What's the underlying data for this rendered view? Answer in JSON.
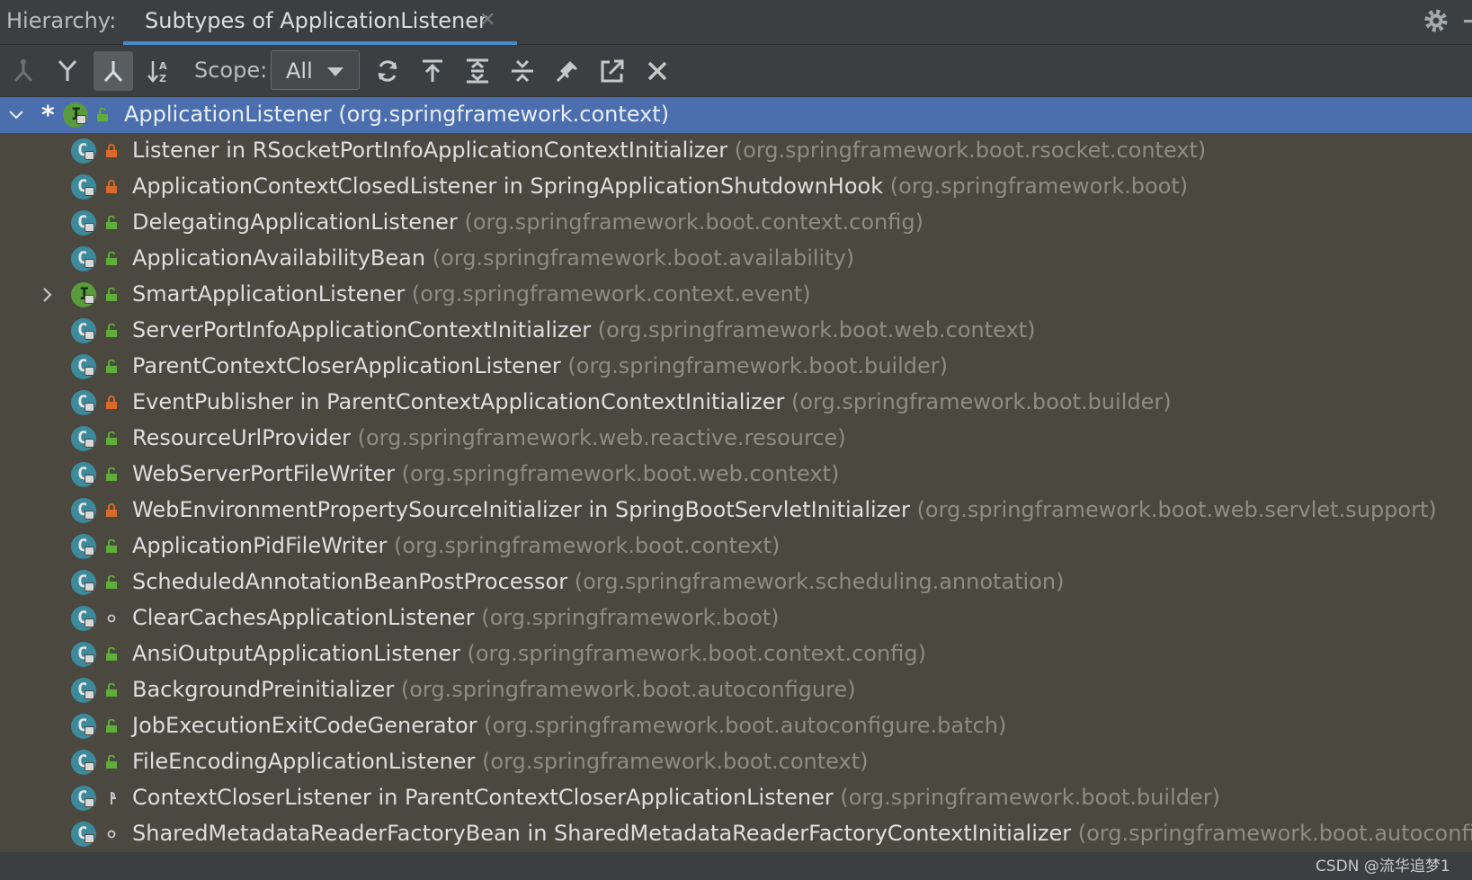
{
  "header": {
    "title": "Hierarchy:",
    "tab_label": "Subtypes of ApplicationListener"
  },
  "toolbar": {
    "scope_label": "Scope:",
    "scope_value": "All",
    "buttons": [
      "class-hierarchy-icon",
      "supertypes-icon",
      "subtypes-icon",
      "sort-alpha-icon",
      "refresh-icon",
      "base-on-this-class-icon",
      "expand-all-icon",
      "collapse-all-icon",
      "pin-icon",
      "export-icon",
      "close-icon"
    ]
  },
  "tree": {
    "root": {
      "name": "ApplicationListener",
      "pkg": "(org.springframework.context)",
      "kind": "interface",
      "visibility": "public",
      "expanded": true
    },
    "rows": [
      {
        "name": "Listener in RSocketPortInfoApplicationContextInitializer",
        "pkg": "(org.springframework.boot.rsocket.context)",
        "kind": "class",
        "visibility": "private"
      },
      {
        "name": "ApplicationContextClosedListener in SpringApplicationShutdownHook",
        "pkg": "(org.springframework.boot)",
        "kind": "class",
        "visibility": "private"
      },
      {
        "name": "DelegatingApplicationListener",
        "pkg": "(org.springframework.boot.context.config)",
        "kind": "class",
        "visibility": "public"
      },
      {
        "name": "ApplicationAvailabilityBean",
        "pkg": "(org.springframework.boot.availability)",
        "kind": "class",
        "visibility": "public"
      },
      {
        "name": "SmartApplicationListener",
        "pkg": "(org.springframework.context.event)",
        "kind": "interface",
        "visibility": "public",
        "collapsed": true
      },
      {
        "name": "ServerPortInfoApplicationContextInitializer",
        "pkg": "(org.springframework.boot.web.context)",
        "kind": "class",
        "visibility": "public"
      },
      {
        "name": "ParentContextCloserApplicationListener",
        "pkg": "(org.springframework.boot.builder)",
        "kind": "class",
        "visibility": "public"
      },
      {
        "name": "EventPublisher in ParentContextApplicationContextInitializer",
        "pkg": "(org.springframework.boot.builder)",
        "kind": "class",
        "visibility": "private"
      },
      {
        "name": "ResourceUrlProvider",
        "pkg": "(org.springframework.web.reactive.resource)",
        "kind": "class",
        "visibility": "public"
      },
      {
        "name": "WebServerPortFileWriter",
        "pkg": "(org.springframework.boot.web.context)",
        "kind": "class",
        "visibility": "public"
      },
      {
        "name": "WebEnvironmentPropertySourceInitializer in SpringBootServletInitializer",
        "pkg": "(org.springframework.boot.web.servlet.support)",
        "kind": "class",
        "visibility": "private"
      },
      {
        "name": "ApplicationPidFileWriter",
        "pkg": "(org.springframework.boot.context)",
        "kind": "class",
        "visibility": "public"
      },
      {
        "name": "ScheduledAnnotationBeanPostProcessor",
        "pkg": "(org.springframework.scheduling.annotation)",
        "kind": "class",
        "visibility": "public"
      },
      {
        "name": "ClearCachesApplicationListener",
        "pkg": "(org.springframework.boot)",
        "kind": "class",
        "visibility": "package"
      },
      {
        "name": "AnsiOutputApplicationListener",
        "pkg": "(org.springframework.boot.context.config)",
        "kind": "class",
        "visibility": "public"
      },
      {
        "name": "BackgroundPreinitializer",
        "pkg": "(org.springframework.boot.autoconfigure)",
        "kind": "class",
        "visibility": "public"
      },
      {
        "name": "JobExecutionExitCodeGenerator",
        "pkg": "(org.springframework.boot.autoconfigure.batch)",
        "kind": "class",
        "visibility": "public"
      },
      {
        "name": "FileEncodingApplicationListener",
        "pkg": "(org.springframework.boot.context)",
        "kind": "class",
        "visibility": "public"
      },
      {
        "name": "ContextCloserListener in ParentContextCloserApplicationListener",
        "pkg": "(org.springframework.boot.builder)",
        "kind": "class",
        "visibility": "protected"
      },
      {
        "name": "SharedMetadataReaderFactoryBean in SharedMetadataReaderFactoryContextInitializer",
        "pkg": "(org.springframework.boot.autoconfigure)",
        "kind": "class",
        "visibility": "package"
      }
    ]
  },
  "colors": {
    "selection": "#4b6eaf",
    "background": "#4b483f",
    "class_icon": "#3c8a9c",
    "interface_icon": "#5b9b3e",
    "public": "#5fae3a",
    "private": "#d96a2a"
  },
  "watermark": "CSDN @流华追梦1"
}
